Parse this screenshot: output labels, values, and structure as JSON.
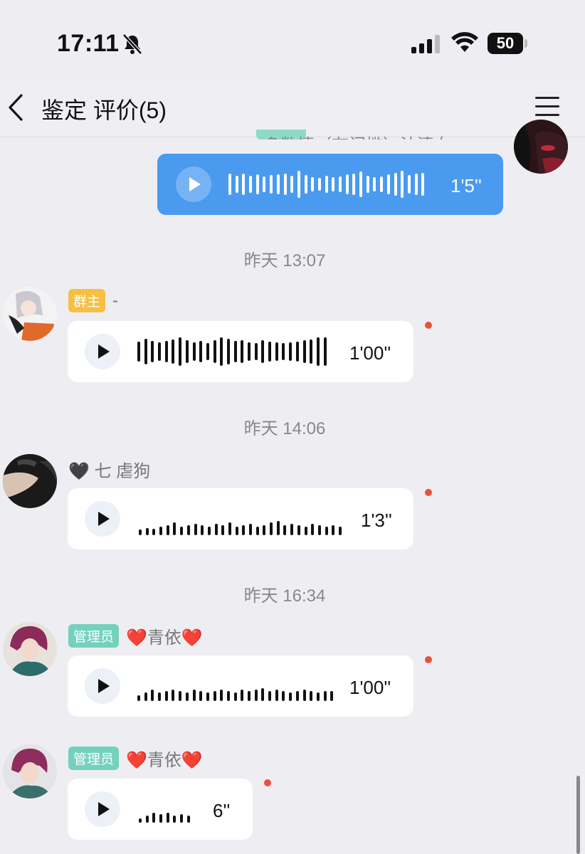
{
  "status_bar": {
    "time": "17:11",
    "battery": "50"
  },
  "nav": {
    "title": "鉴定 评价(5)"
  },
  "partial_top": {
    "name": "多数情（有门槛）油清女"
  },
  "messages": [
    {
      "type": "own",
      "duration": "1'5''"
    },
    {
      "timestamp": "昨天 13:07",
      "badge": "群主",
      "name": "-",
      "duration": "1'00''"
    },
    {
      "timestamp": "昨天 14:06",
      "badge": "",
      "name": "🖤 七  虐狗",
      "duration": "1'3''"
    },
    {
      "timestamp": "昨天 16:34",
      "badge": "管理员",
      "name": "❤️青依❤️",
      "duration": "1'00''"
    },
    {
      "badge": "管理员",
      "name": "❤️青依❤️",
      "duration": "6''"
    }
  ],
  "colors": {
    "own_bubble": "#4a9af0",
    "unread_dot": "#e8503e",
    "owner_badge": "#f6c044",
    "admin_badge": "#73d1bd"
  }
}
